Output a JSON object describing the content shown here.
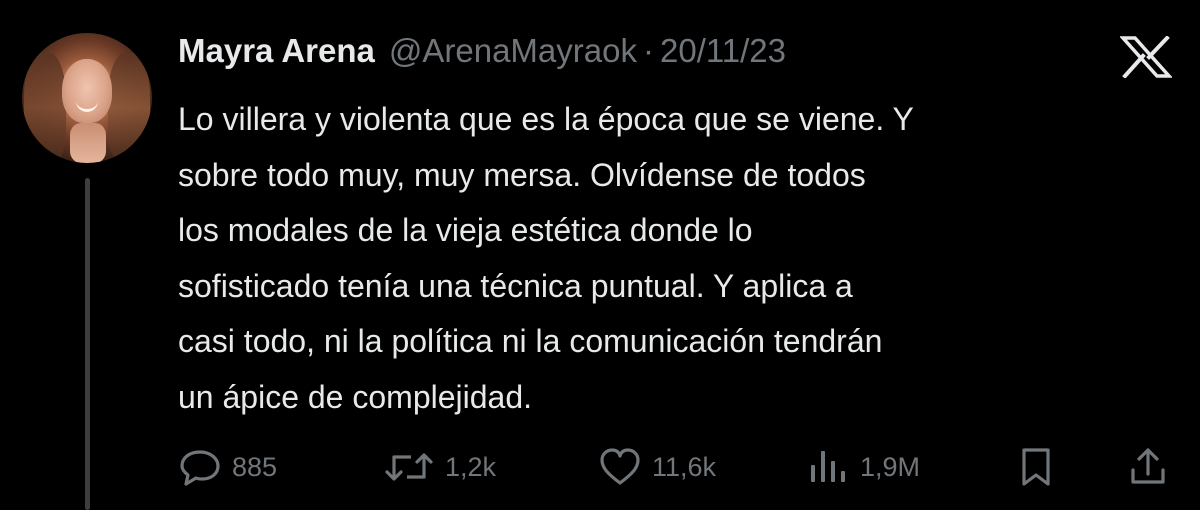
{
  "author": {
    "name": "Mayra Arena",
    "handle": "@ArenaMayraok",
    "separator": "·",
    "date": "20/11/23"
  },
  "brand_icon": "x-logo-icon",
  "tweet": {
    "lines": [
      "Lo villera y violenta que es la época que se viene. Y",
      "sobre todo muy, muy mersa. Olvídense de todos",
      "los modales de la vieja estética donde lo",
      "sofisticado tenía una técnica puntual. Y aplica a",
      "casi todo, ni la política ni la comunicación tendrán",
      "un ápice de complejidad."
    ]
  },
  "actions": {
    "replies": {
      "icon": "reply-icon",
      "count": "885"
    },
    "retweets": {
      "icon": "retweet-icon",
      "count": "1,2k"
    },
    "likes": {
      "icon": "heart-icon",
      "count": "11,6k"
    },
    "views": {
      "icon": "views-icon",
      "count": "1,9M"
    },
    "bookmark": {
      "icon": "bookmark-icon"
    },
    "share": {
      "icon": "share-icon"
    }
  },
  "colors": {
    "background": "#000000",
    "primary_text": "#e7e9ea",
    "secondary_text": "#71767b",
    "thread_line": "#3d3d3d"
  }
}
